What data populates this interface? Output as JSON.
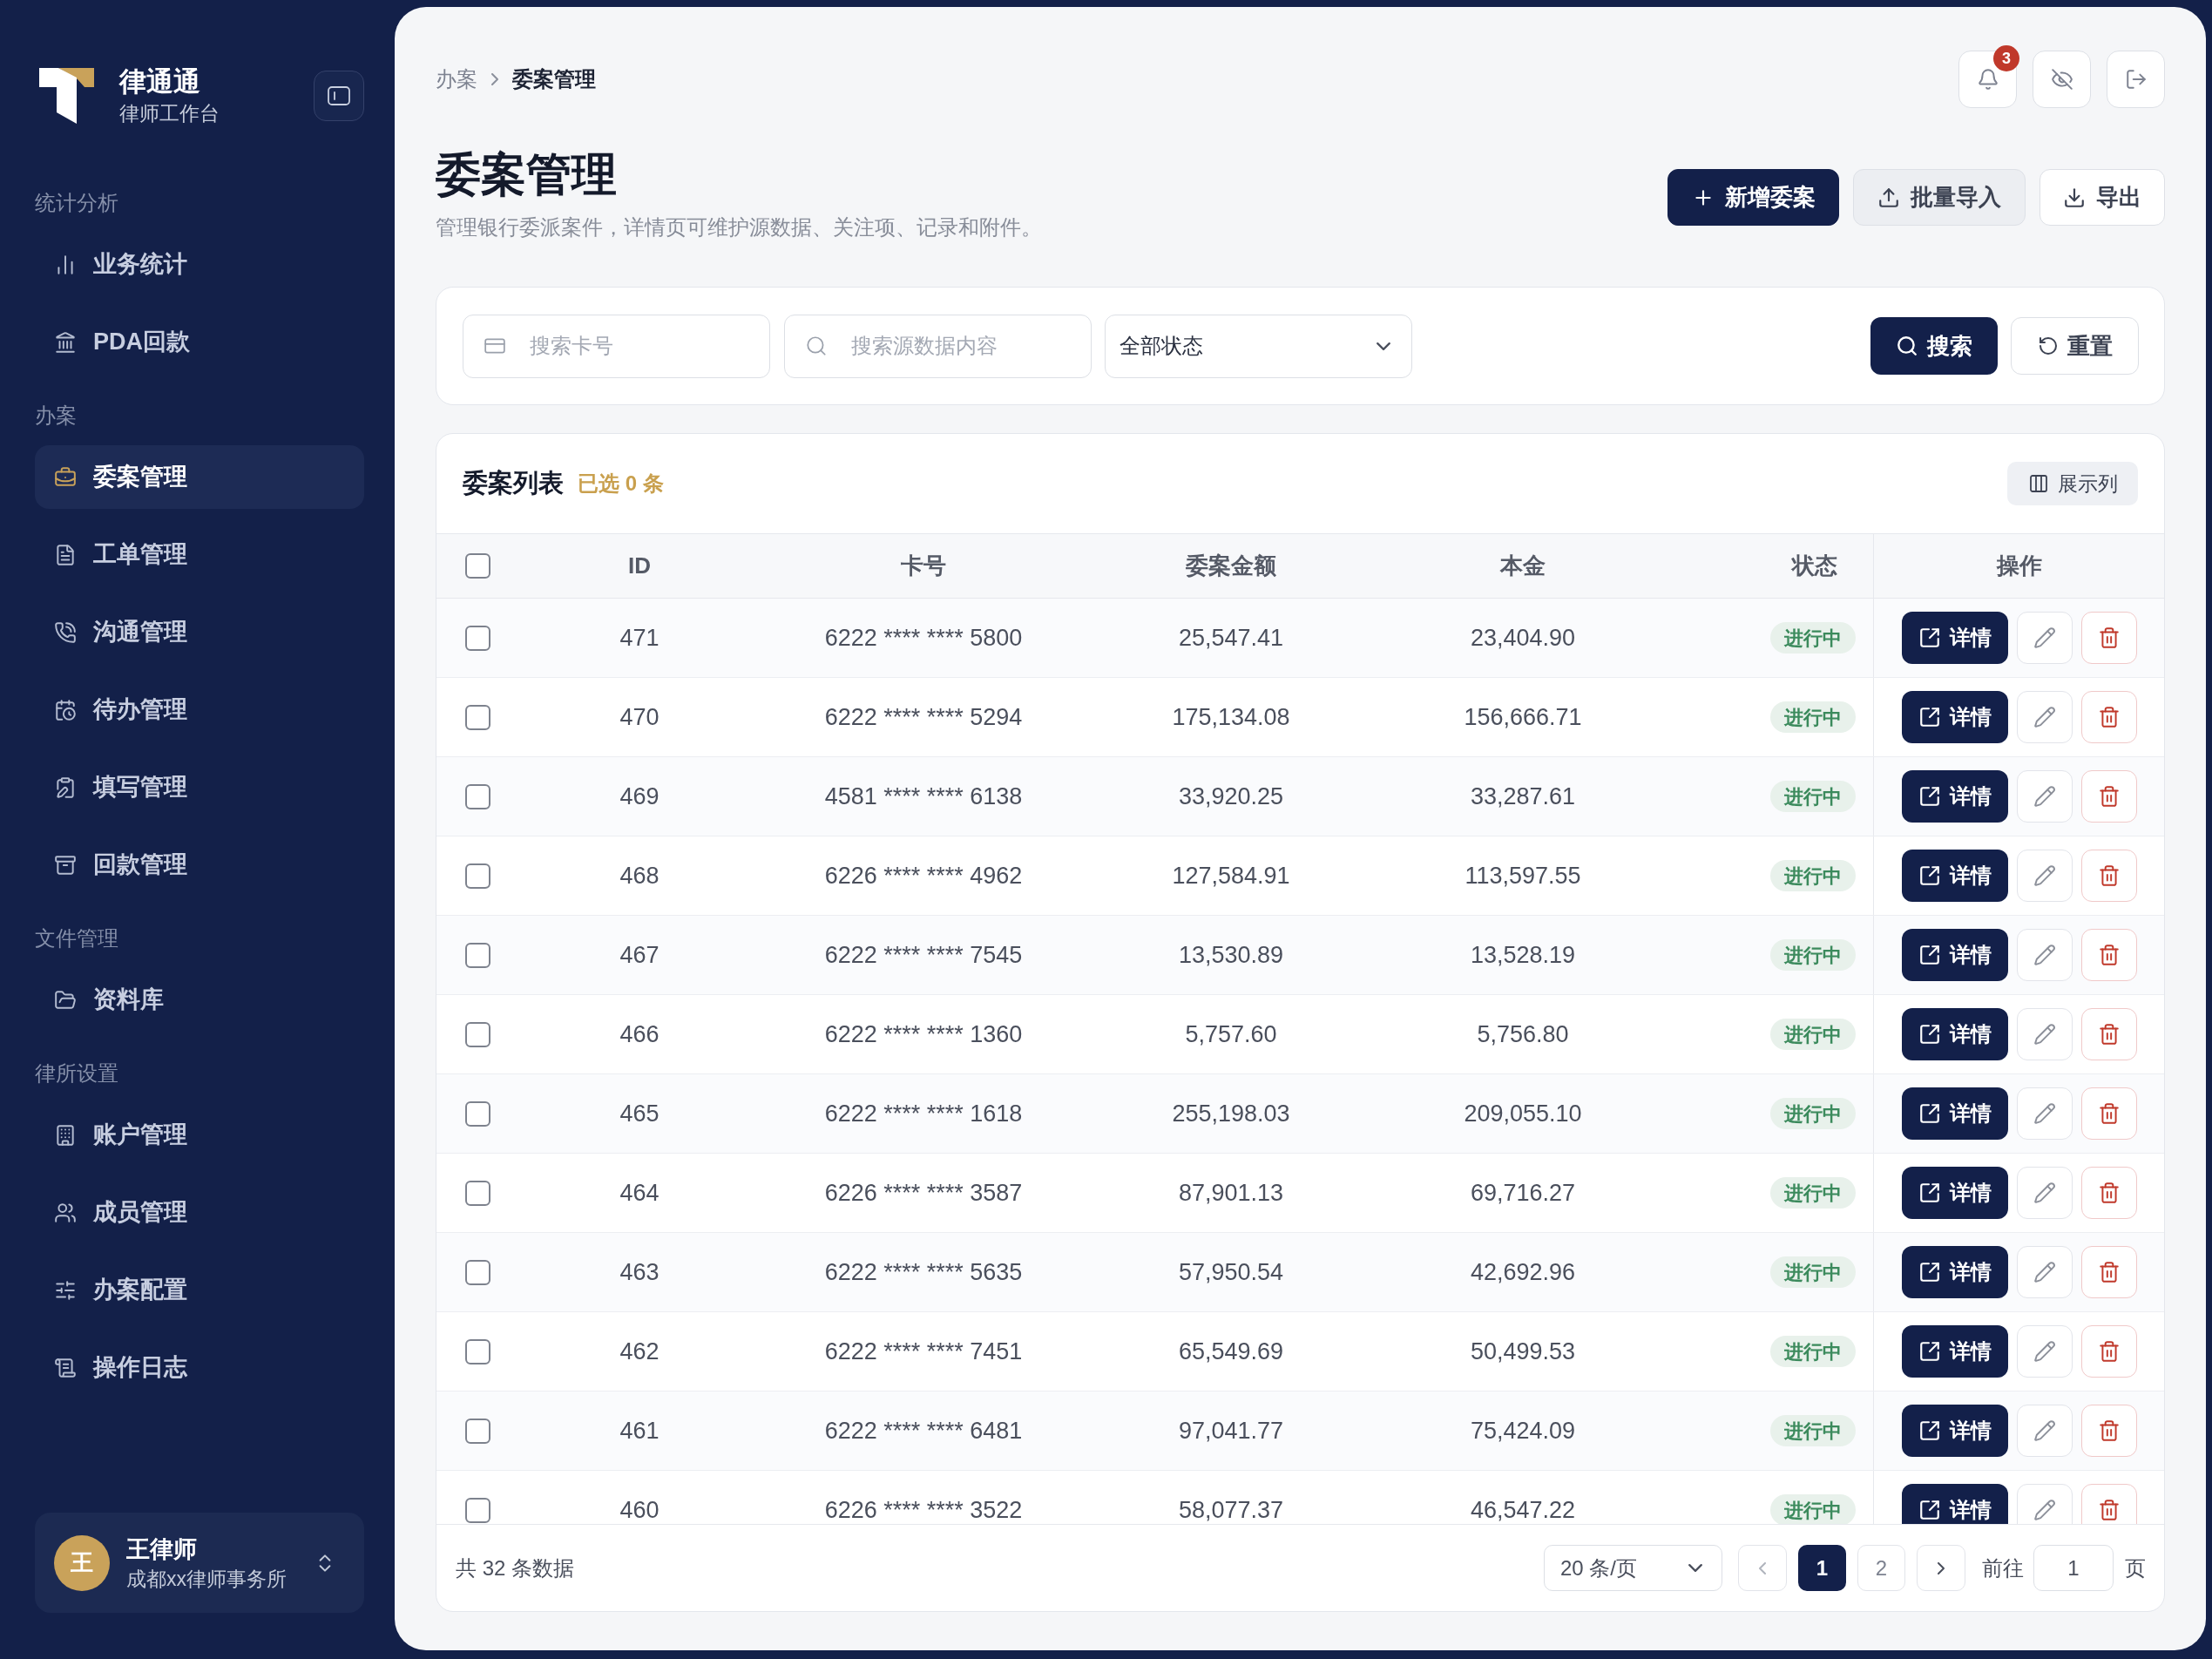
{
  "sidebar": {
    "brand": {
      "name": "律通通",
      "tagline": "律师工作台"
    },
    "sections": [
      {
        "label": "统计分析",
        "items": [
          {
            "label": "业务统计",
            "selected": false
          },
          {
            "label": "PDA回款",
            "selected": false
          }
        ]
      },
      {
        "label": "办案",
        "items": [
          {
            "label": "委案管理",
            "selected": true
          },
          {
            "label": "工单管理",
            "selected": false
          },
          {
            "label": "沟通管理",
            "selected": false
          },
          {
            "label": "待办管理",
            "selected": false
          },
          {
            "label": "填写管理",
            "selected": false
          },
          {
            "label": "回款管理",
            "selected": false
          }
        ]
      },
      {
        "label": "文件管理",
        "items": [
          {
            "label": "资料库",
            "selected": false
          }
        ]
      },
      {
        "label": "律所设置",
        "items": [
          {
            "label": "账户管理",
            "selected": false
          },
          {
            "label": "成员管理",
            "selected": false
          },
          {
            "label": "办案配置",
            "selected": false
          },
          {
            "label": "操作日志",
            "selected": false
          }
        ]
      }
    ],
    "user": {
      "avatar": "王",
      "name": "王律师",
      "org": "成都xx律师事务所"
    }
  },
  "breadcrumb": [
    {
      "label": "办案",
      "current": false
    },
    {
      "label": "委案管理",
      "current": true
    }
  ],
  "notifications": "3",
  "page": {
    "title": "委案管理",
    "subtitle": "管理银行委派案件，详情页可维护源数据、关注项、记录和附件。"
  },
  "actions": [
    {
      "label": "新增委案",
      "kind": "primary"
    },
    {
      "label": "批量导入",
      "kind": "secondary"
    },
    {
      "label": "导出",
      "kind": "outline"
    }
  ],
  "filters": {
    "card_number": {
      "placeholder": "搜索卡号"
    },
    "source_search": {
      "placeholder": "搜索源数据内容"
    },
    "status": {
      "value": "全部状态"
    },
    "search_button": "搜索",
    "reset_button": "重置"
  },
  "table": {
    "title": "委案列表",
    "selection_count": "已选 0 条",
    "column_toggle": "展示列",
    "select_all": {
      "checked": false
    },
    "columns": [
      "ID",
      "卡号",
      "委案金额",
      "本金",
      "状态",
      "操作"
    ],
    "rows": [
      {
        "id": "471",
        "card": "6222 **** **** 5800",
        "amount": "25,547.41",
        "principal": "23,404.90",
        "status": "进行中",
        "detail": "详情",
        "checked": false
      },
      {
        "id": "470",
        "card": "6222 **** **** 5294",
        "amount": "175,134.08",
        "principal": "156,666.71",
        "status": "进行中",
        "detail": "详情",
        "checked": false
      },
      {
        "id": "469",
        "card": "4581 **** **** 6138",
        "amount": "33,920.25",
        "principal": "33,287.61",
        "status": "进行中",
        "detail": "详情",
        "checked": false
      },
      {
        "id": "468",
        "card": "6226 **** **** 4962",
        "amount": "127,584.91",
        "principal": "113,597.55",
        "status": "进行中",
        "detail": "详情",
        "checked": false
      },
      {
        "id": "467",
        "card": "6222 **** **** 7545",
        "amount": "13,530.89",
        "principal": "13,528.19",
        "status": "进行中",
        "detail": "详情",
        "checked": false
      },
      {
        "id": "466",
        "card": "6222 **** **** 1360",
        "amount": "5,757.60",
        "principal": "5,756.80",
        "status": "进行中",
        "detail": "详情",
        "checked": false
      },
      {
        "id": "465",
        "card": "6222 **** **** 1618",
        "amount": "255,198.03",
        "principal": "209,055.10",
        "status": "进行中",
        "detail": "详情",
        "checked": false
      },
      {
        "id": "464",
        "card": "6226 **** **** 3587",
        "amount": "87,901.13",
        "principal": "69,716.27",
        "status": "进行中",
        "detail": "详情",
        "checked": false
      },
      {
        "id": "463",
        "card": "6222 **** **** 5635",
        "amount": "57,950.54",
        "principal": "42,692.96",
        "status": "进行中",
        "detail": "详情",
        "checked": false
      },
      {
        "id": "462",
        "card": "6222 **** **** 7451",
        "amount": "65,549.69",
        "principal": "50,499.53",
        "status": "进行中",
        "detail": "详情",
        "checked": false
      },
      {
        "id": "461",
        "card": "6222 **** **** 6481",
        "amount": "97,041.77",
        "principal": "75,424.09",
        "status": "进行中",
        "detail": "详情",
        "checked": false
      },
      {
        "id": "460",
        "card": "6226 **** **** 3522",
        "amount": "58,077.37",
        "principal": "46,547.22",
        "status": "进行中",
        "detail": "详情",
        "checked": false
      }
    ]
  },
  "pagination": {
    "total": "共 32 条数据",
    "page_size": "20 条/页",
    "pages": [
      {
        "label": "1",
        "selected": true
      },
      {
        "label": "2",
        "selected": false
      }
    ],
    "goto_label": "前往",
    "goto_value": "1",
    "page_unit": "页"
  }
}
